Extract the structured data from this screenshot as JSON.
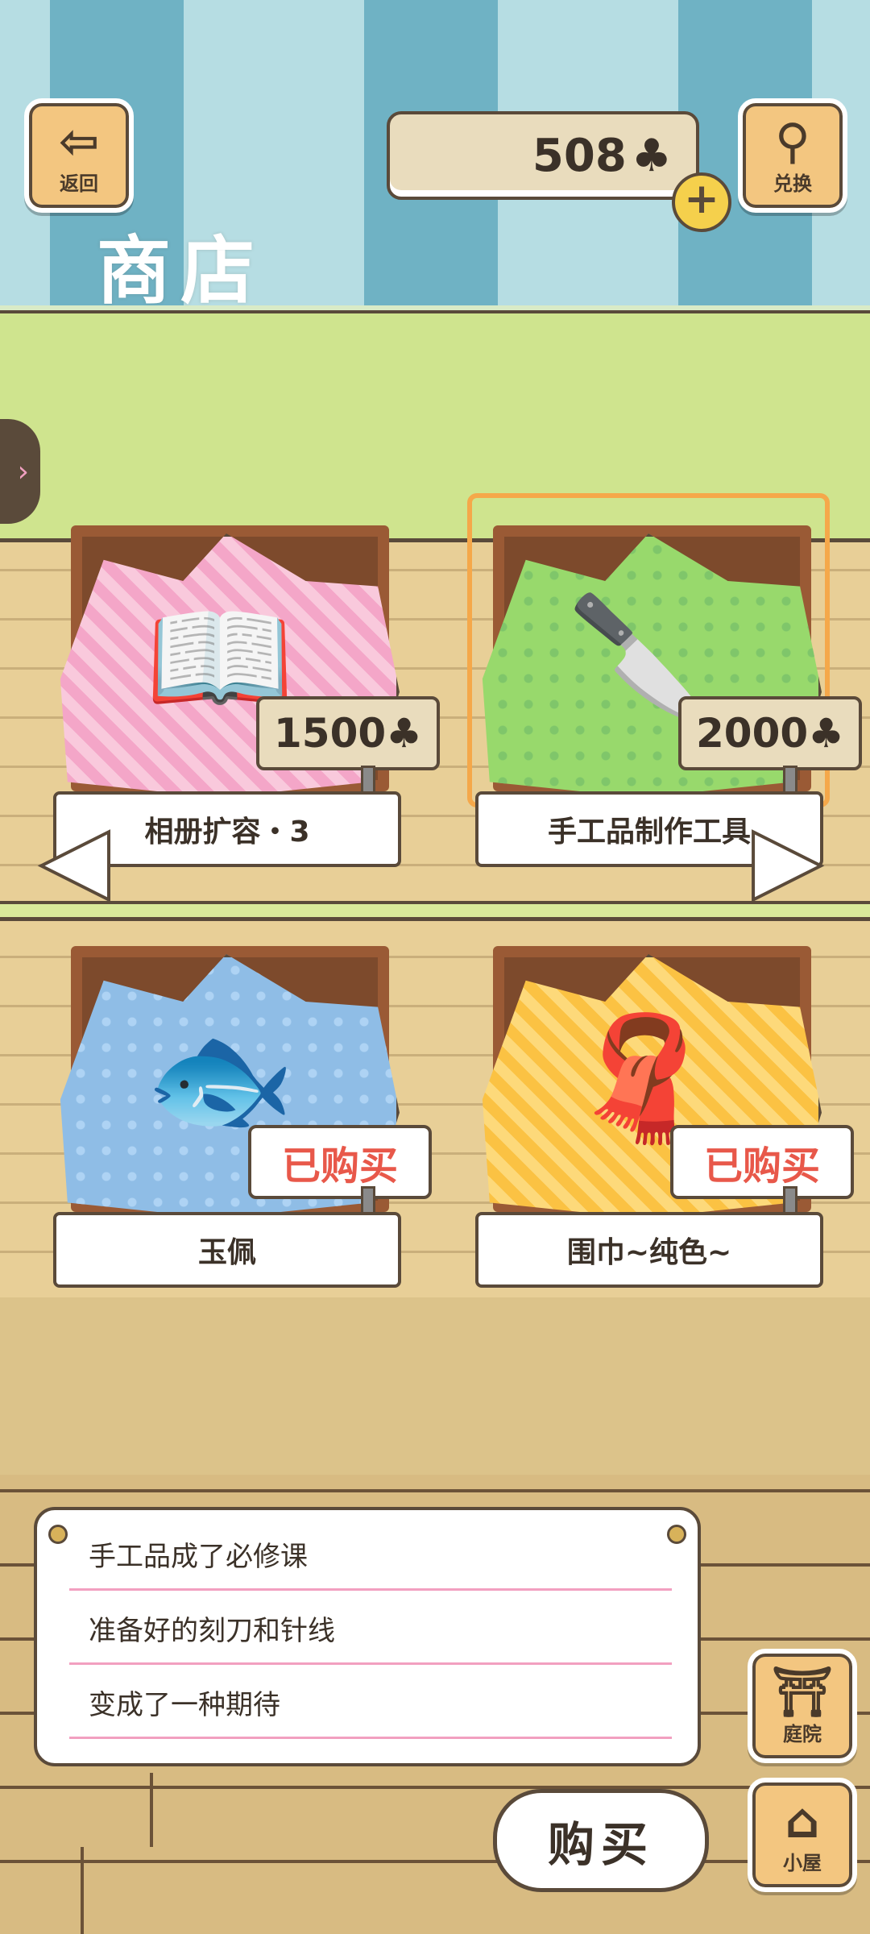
{
  "header": {
    "back_label": "返回",
    "exchange_label": "兑换",
    "title": "商店",
    "currency_amount": "508",
    "currency_icon": "clover-icon",
    "plus_label": "+"
  },
  "items": [
    {
      "name": "相册扩容・3",
      "price": "1500",
      "status": "price",
      "icon": "photo-album-icon",
      "cloth_color": "#f4a6c8"
    },
    {
      "name": "手工品制作工具",
      "price": "2000",
      "status": "price",
      "icon": "craft-tools-icon",
      "cloth_color": "#98d96c",
      "selected": true
    },
    {
      "name": "玉佩",
      "bought_label": "已购买",
      "status": "bought",
      "icon": "koi-jade-icon",
      "cloth_color": "#8fbde6"
    },
    {
      "name": "围巾~纯色~",
      "bought_label": "已购买",
      "status": "bought",
      "icon": "scarf-icon",
      "cloth_color": "#fbc243"
    }
  ],
  "clover_symbol": "♣",
  "description": {
    "lines": [
      "手工品成了必修课",
      "准备好的刻刀和针线",
      "变成了一种期待"
    ]
  },
  "buy_label": "购买",
  "bottom_nav": {
    "yard_label": "庭院",
    "house_label": "小屋"
  },
  "colors": {
    "accent": "#f5a84a",
    "bought_red": "#e8584a",
    "outline": "#5a4a3a"
  }
}
